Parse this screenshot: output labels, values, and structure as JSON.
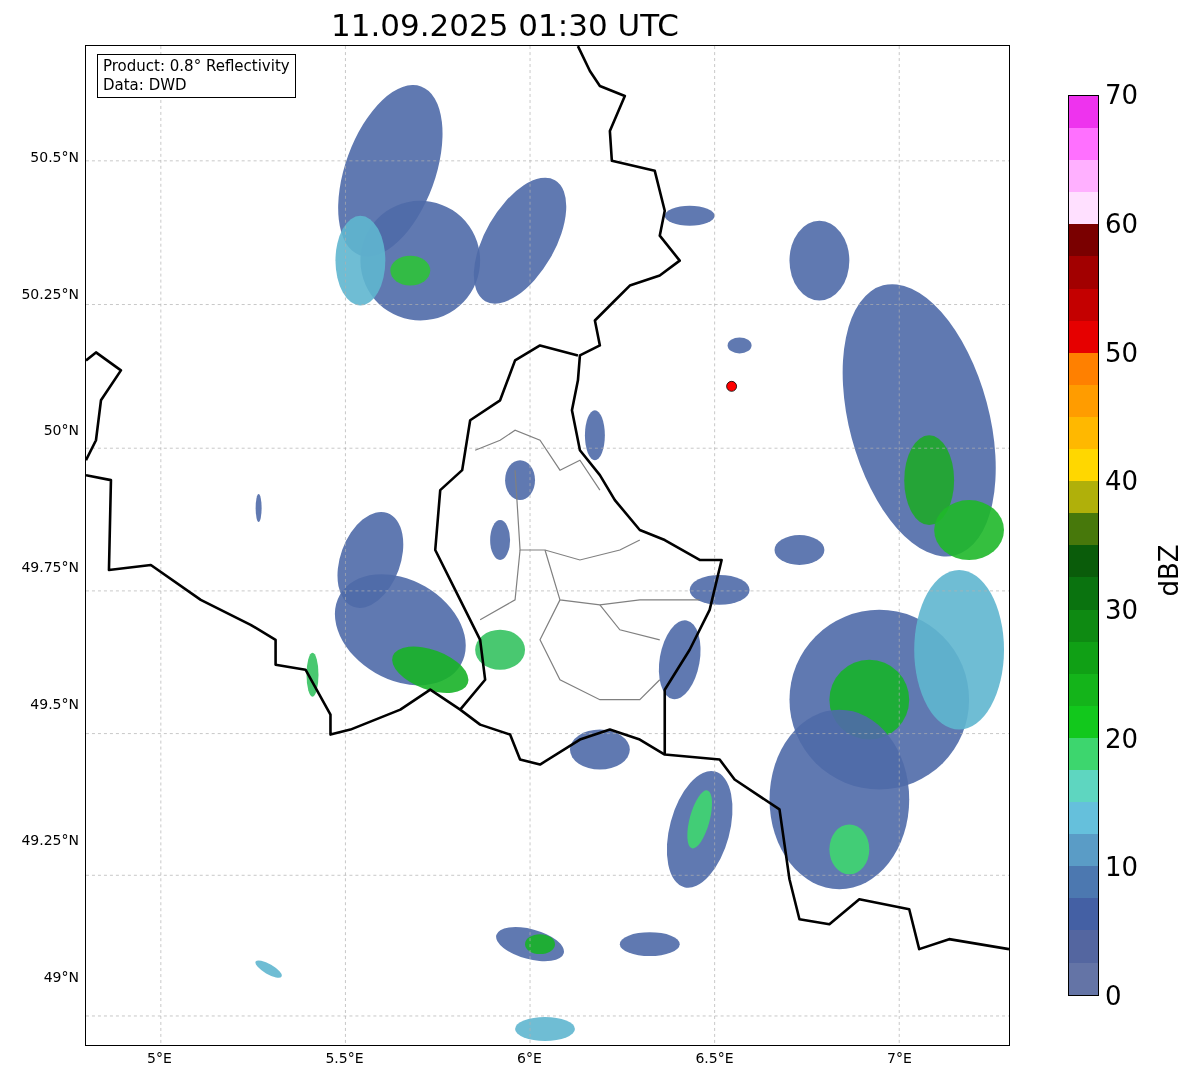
{
  "title": "11.09.2025 01:30 UTC",
  "info_box": [
    "Product: 0.8° Reflectivity",
    "Data: DWD"
  ],
  "y_ticks": [
    "50.5°N",
    "50.25°N",
    "50°N",
    "49.75°N",
    "49.5°N",
    "49.25°N",
    "49°N"
  ],
  "x_ticks": [
    "5°E",
    "5.5°E",
    "6°E",
    "6.5°E",
    "7°E"
  ],
  "colorbar": {
    "label": "dBZ",
    "ticks": [
      "70",
      "60",
      "50",
      "40",
      "30",
      "20",
      "10",
      "0"
    ],
    "segments": [
      {
        "color": "#ee33ee"
      },
      {
        "color": "#ff70ff"
      },
      {
        "color": "#ffb0ff"
      },
      {
        "color": "#ffe0ff"
      },
      {
        "color": "#7a0000"
      },
      {
        "color": "#a20000"
      },
      {
        "color": "#c40000"
      },
      {
        "color": "#e60000"
      },
      {
        "color": "#ff8000"
      },
      {
        "color": "#ff9c00"
      },
      {
        "color": "#ffb800"
      },
      {
        "color": "#ffd700"
      },
      {
        "color": "#b0b00a"
      },
      {
        "color": "#47780b"
      },
      {
        "color": "#0a5c0a"
      },
      {
        "color": "#0a730f"
      },
      {
        "color": "#0e8a12"
      },
      {
        "color": "#10a015"
      },
      {
        "color": "#14b41a"
      },
      {
        "color": "#12c81c"
      },
      {
        "color": "#3dd66e"
      },
      {
        "color": "#5ed6c0"
      },
      {
        "color": "#65c0dc"
      },
      {
        "color": "#5a9cc6"
      },
      {
        "color": "#4c78b0"
      },
      {
        "color": "#4460a4"
      },
      {
        "color": "#5466a0"
      },
      {
        "color": "#6474a6"
      }
    ]
  }
}
